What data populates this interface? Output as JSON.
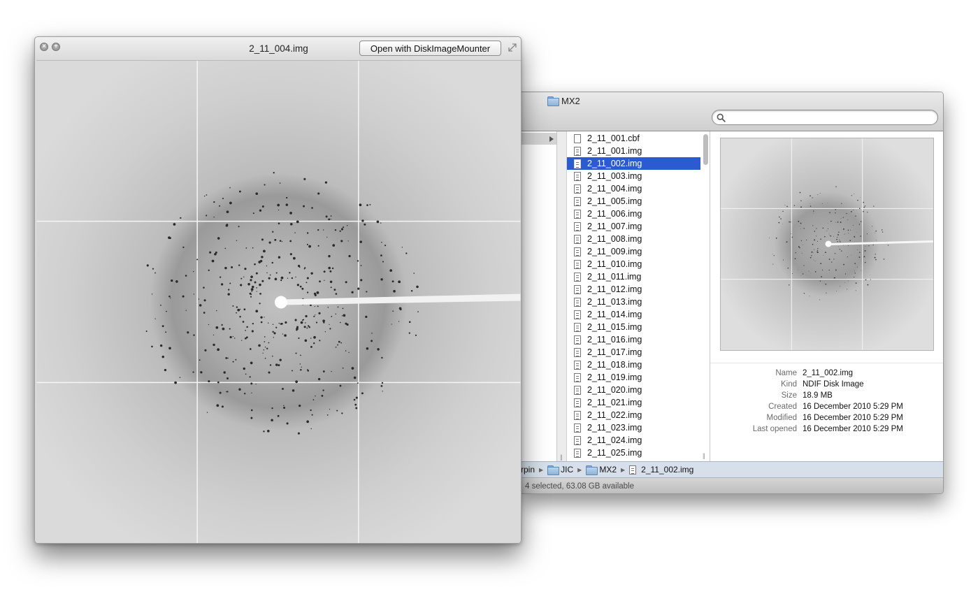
{
  "quicklook": {
    "title": "2_11_004.img",
    "open_with_label": "Open with DiskImageMounter",
    "close_icon": "close-icon",
    "fullscreen_icon": "expand-arrows-icon"
  },
  "finder": {
    "folder_title": "MX2",
    "search": {
      "value": "",
      "placeholder": ""
    },
    "files": [
      {
        "name": "2_11_001.cbf",
        "icon": "document-icon"
      },
      {
        "name": "2_11_001.img",
        "icon": "disk-image-icon"
      },
      {
        "name": "2_11_002.img",
        "icon": "disk-image-icon",
        "selected": true
      },
      {
        "name": "2_11_003.img",
        "icon": "disk-image-icon"
      },
      {
        "name": "2_11_004.img",
        "icon": "disk-image-icon"
      },
      {
        "name": "2_11_005.img",
        "icon": "disk-image-icon"
      },
      {
        "name": "2_11_006.img",
        "icon": "disk-image-icon"
      },
      {
        "name": "2_11_007.img",
        "icon": "disk-image-icon"
      },
      {
        "name": "2_11_008.img",
        "icon": "disk-image-icon"
      },
      {
        "name": "2_11_009.img",
        "icon": "disk-image-icon"
      },
      {
        "name": "2_11_010.img",
        "icon": "disk-image-icon"
      },
      {
        "name": "2_11_011.img",
        "icon": "disk-image-icon"
      },
      {
        "name": "2_11_012.img",
        "icon": "disk-image-icon"
      },
      {
        "name": "2_11_013.img",
        "icon": "disk-image-icon"
      },
      {
        "name": "2_11_014.img",
        "icon": "disk-image-icon"
      },
      {
        "name": "2_11_015.img",
        "icon": "disk-image-icon"
      },
      {
        "name": "2_11_016.img",
        "icon": "disk-image-icon"
      },
      {
        "name": "2_11_017.img",
        "icon": "disk-image-icon"
      },
      {
        "name": "2_11_018.img",
        "icon": "disk-image-icon"
      },
      {
        "name": "2_11_019.img",
        "icon": "disk-image-icon"
      },
      {
        "name": "2_11_020.img",
        "icon": "disk-image-icon"
      },
      {
        "name": "2_11_021.img",
        "icon": "disk-image-icon"
      },
      {
        "name": "2_11_022.img",
        "icon": "disk-image-icon"
      },
      {
        "name": "2_11_023.img",
        "icon": "disk-image-icon"
      },
      {
        "name": "2_11_024.img",
        "icon": "disk-image-icon"
      },
      {
        "name": "2_11_025.img",
        "icon": "disk-image-icon"
      }
    ],
    "info": [
      {
        "key": "Name",
        "value": "2_11_002.img"
      },
      {
        "key": "Kind",
        "value": "NDIF Disk Image"
      },
      {
        "key": "Size",
        "value": "18.9 MB"
      },
      {
        "key": "Created",
        "value": "16 December 2010 5:29 PM"
      },
      {
        "key": "Modified",
        "value": "16 December 2010 5:29 PM"
      },
      {
        "key": "Last opened",
        "value": "16 December 2010 5:29 PM"
      }
    ],
    "path": [
      "rpin",
      "JIC",
      "MX2",
      "2_11_002.img"
    ],
    "status": "4 selected, 63.08 GB available"
  },
  "colors": {
    "selection": "#2c5bd1",
    "pathbar": "#d7e0ea",
    "diffraction_background": "#cfcfcf"
  }
}
